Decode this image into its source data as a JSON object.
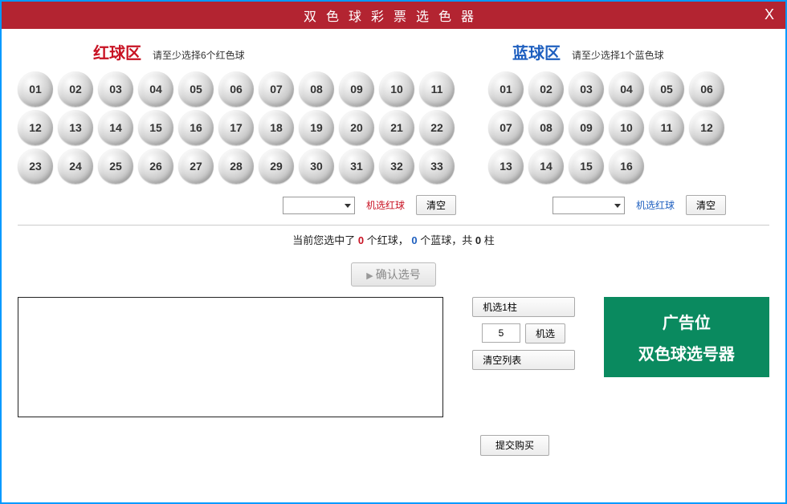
{
  "titlebar": {
    "title": "双色球彩票选色器",
    "close": "X"
  },
  "red": {
    "title": "红球区",
    "hint": "请至少选择6个红色球",
    "balls": [
      "01",
      "02",
      "03",
      "04",
      "05",
      "06",
      "07",
      "08",
      "09",
      "10",
      "11",
      "12",
      "13",
      "14",
      "15",
      "16",
      "17",
      "18",
      "19",
      "20",
      "21",
      "22",
      "23",
      "24",
      "25",
      "26",
      "27",
      "28",
      "29",
      "30",
      "31",
      "32",
      "33"
    ],
    "random_label": "机选红球",
    "clear_label": "清空"
  },
  "blue": {
    "title": "蓝球区",
    "hint": "请至少选择1个蓝色球",
    "balls": [
      "01",
      "02",
      "03",
      "04",
      "05",
      "06",
      "07",
      "08",
      "09",
      "10",
      "11",
      "12",
      "13",
      "14",
      "15",
      "16"
    ],
    "random_label": "机选红球",
    "clear_label": "清空"
  },
  "summary": {
    "prefix": "当前您选中了 ",
    "red_count": "0",
    "red_unit": " 个红球，",
    "blue_count": "0",
    "blue_unit": " 个蓝球，共 ",
    "total": "0",
    "total_unit": " 柱"
  },
  "confirm": "确认选号",
  "side": {
    "random_one": "机选1柱",
    "qty": "5",
    "random": "机选",
    "clear_list": "清空列表",
    "submit": "提交购买"
  },
  "ad": {
    "line1": "广告位",
    "line2": "双色球选号器"
  }
}
